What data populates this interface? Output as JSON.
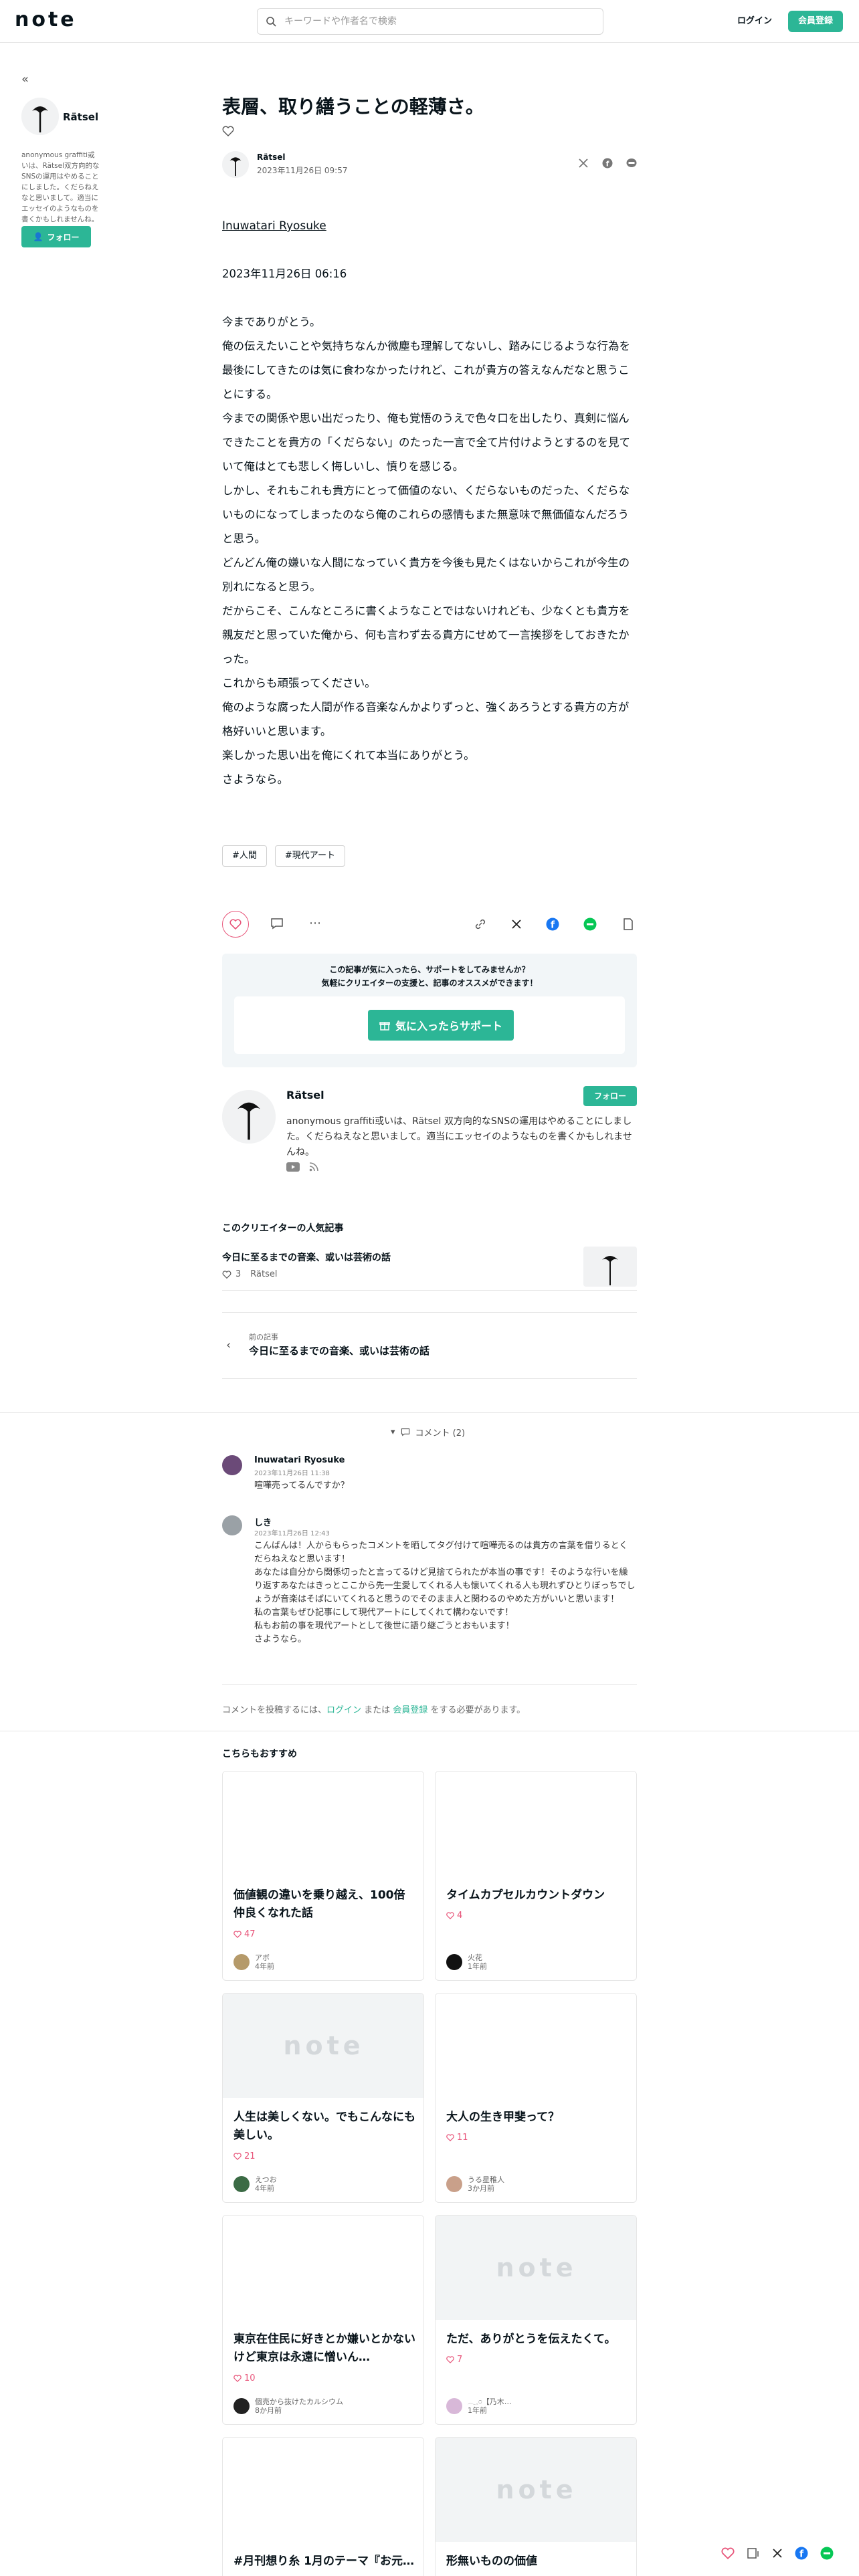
{
  "header": {
    "logo": "note",
    "search_placeholder": "キーワードや作者名で検索",
    "login": "ログイン",
    "signup": "会員登録"
  },
  "sidebar": {
    "author_name": "Rätsel",
    "description": "anonymous graffiti或いは、Rätsel双方向的なSNSの運用はやめることにしました。くだらねえなと思いまして。適当にエッセイのようなものを書くかもしれませんね。",
    "follow": "フォロー"
  },
  "article": {
    "title": "表層、取り繕うことの軽薄さ。",
    "author": "Rätsel",
    "date": "2023年11月26日 09:57",
    "addressee": "Inuwatari Ryosuke",
    "letter_date": "2023年11月26日 06:16",
    "paragraphs": [
      "今までありがとう。",
      "俺の伝えたいことや気持ちなんか微塵も理解してないし、踏みにじるような行為を最後にしてきたのは気に食わなかったけれど、これが貴方の答えなんだなと思うことにする。",
      "今までの関係や思い出だったり、俺も覚悟のうえで色々口を出したり、真剣に悩んできたことを貴方の「くだらない」のたった一言で全て片付けようとするのを見ていて俺はとても悲しく悔しいし、憤りを感じる。",
      "しかし、それもこれも貴方にとって価値のない、くだらないものだった、くだらないものになってしまったのなら俺のこれらの感情もまた無意味で無価値なんだろうと思う。",
      "どんどん俺の嫌いな人間になっていく貴方を今後も見たくはないからこれが今生の別れになると思う。",
      "だからこそ、こんなところに書くようなことではないけれども、少なくとも貴方を親友だと思っていた俺から、何も言わず去る貴方にせめて一言挨拶をしておきたかった。",
      "これからも頑張ってください。",
      "俺のような腐った人間が作る音楽なんかよりずっと、強くあろうとする貴方の方が格好いいと思います。",
      "楽しかった思い出を俺にくれて本当にありがとう。",
      "さようなら。"
    ],
    "tags": [
      "#人間",
      "#現代アート"
    ]
  },
  "support": {
    "line1": "この記事が気に入ったら、サポートをしてみませんか？",
    "line2": "気軽にクリエイターの支援と、記事のオススメができます！",
    "button": "気に入ったらサポート"
  },
  "creator": {
    "name": "Rätsel",
    "follow": "フォロー",
    "description": "anonymous graffiti或いは、Rätsel 双方向的なSNSの運用はやめることにしました。くだらねえなと思いまして。適当にエッセイのようなものを書くかもしれませんね。"
  },
  "popular": {
    "heading": "このクリエイターの人気記事",
    "title": "今日に至るまでの音楽、或いは芸術の話",
    "likes": "3",
    "author": "Rätsel"
  },
  "prev": {
    "label": "前の記事",
    "title": "今日に至るまでの音楽、或いは芸術の話"
  },
  "comments": {
    "toggle": "コメント (2)",
    "items": [
      {
        "name": "Inuwatari Ryosuke",
        "date": "2023年11月26日 11:38",
        "text": "喧嘩売ってるんですか？"
      },
      {
        "name": "しき",
        "date": "2023年11月26日 12:43",
        "text": "こんばんは！人からもらったコメントを晒してタグ付けて喧嘩売るのは貴方の言葉を借りるとくだらねえなと思います！\nあなたは自分から関係切ったと言ってるけど見捨てられたが本当の事です！そのような行いを繰り返すあなたはきっとここから先一生愛してくれる人も懐いてくれる人も現れずひとりぼっちでしょうが音楽はそばにいてくれると思うのでそのまま人と関わるのやめた方がいいと思います！\n私の言葉もぜひ記事にして現代アートにしてくれて構わないです！\n私もお前の事を現代アートとして後世に語り継ごうとおもいます！\nさようなら。"
      }
    ],
    "note_prefix": "コメントを投稿するには、",
    "note_login": "ログイン",
    "note_mid": " または ",
    "note_signup": "会員登録",
    "note_suffix": " をする必要があります。"
  },
  "recommend": {
    "heading": "こちらもおすすめ",
    "cards": [
      {
        "title": "価値観の違いを乗り越え、100倍仲良くなれた話",
        "likes": "47",
        "author": "アボ",
        "age": "4年前"
      },
      {
        "title": "タイムカプセルカウントダウン",
        "likes": "4",
        "author": "火花",
        "age": "1年前"
      },
      {
        "title": "人生は美しくない。でもこんなにも美しい。",
        "likes": "21",
        "author": "えつお",
        "age": "4年前"
      },
      {
        "title": "大人の生き甲斐って？",
        "likes": "11",
        "author": "うる星稚人",
        "age": "3か月前"
      },
      {
        "title": "東京在住民に好きとか嫌いとかないけど東京は永遠に憎いん…",
        "likes": "10",
        "author": "個売から抜けたカルシウム",
        "age": "8か月前"
      },
      {
        "title": "ただ、ありがとうを伝えたくて。",
        "likes": "7",
        "author": "𓂃𓈒𓏸【乃木…",
        "age": "1年前"
      },
      {
        "title": "#月刊想り糸 1月のテーマ『お元…",
        "likes": "",
        "author": "",
        "age": ""
      },
      {
        "title": "形無いものの価値",
        "likes": "",
        "author": "",
        "age": ""
      }
    ],
    "placeholder_logo": "note"
  },
  "colors": {
    "accent": "#2cb696",
    "like": "#e8557a"
  }
}
